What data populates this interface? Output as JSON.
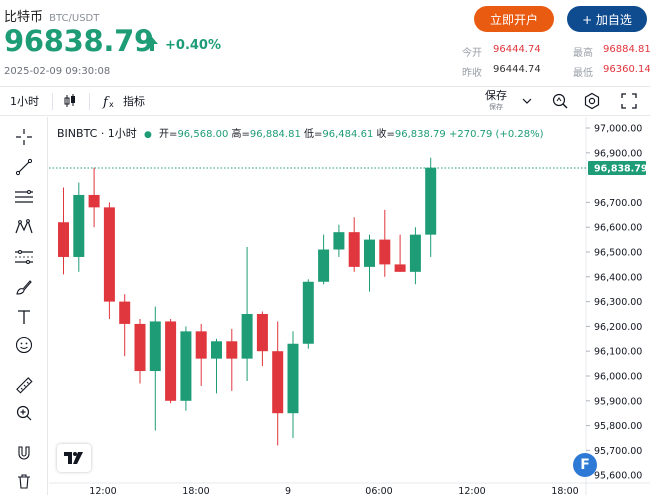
{
  "header": {
    "coin_name": "比特币",
    "pair": "BTC/USDT",
    "price": "96838.79",
    "change_pct": "+0.40%",
    "timestamp": "2025-02-09 09:30:08",
    "open_account_label": "立即开户",
    "add_watchlist_label": "+ 加自选",
    "stats": {
      "open_label": "今开",
      "open_value": "96444.74",
      "high_label": "最高",
      "high_value": "96884.81",
      "prev_close_label": "昨收",
      "prev_close_value": "96444.74",
      "low_label": "最低",
      "low_value": "96360.14"
    },
    "colors": {
      "up": "#1e9c76",
      "down": "#e0363d",
      "open_btn": "#ea5b12",
      "add_btn": "#0f4b8f"
    }
  },
  "toolbar": {
    "interval": "1小时",
    "indicators_label": "指标",
    "save_label": "保存",
    "save_sub_label": "保存",
    "icons": [
      "candles-icon",
      "indicators-icon",
      "alert-icon",
      "settings-icon",
      "fullscreen-icon"
    ]
  },
  "left_tools": [
    "crosshair-icon",
    "trendline-icon",
    "horizontal-lines-icon",
    "pattern-icon",
    "measure-icon",
    "brush-icon",
    "text-icon",
    "emoji-icon",
    "ruler-icon",
    "zoom-icon",
    "magnet-icon",
    "trash-icon"
  ],
  "legend": {
    "symbol": "BINBTC · 1小时",
    "open_label": "开=",
    "open": "96,568.00",
    "high_label": "高=",
    "high": "96,884.81",
    "low_label": "低=",
    "low": "96,484.61",
    "close_label": "收=",
    "close": "96,838.79",
    "change": "+270.79 (+0.28%)"
  },
  "chart_data": {
    "type": "candlestick",
    "title": "BINBTC · 1小时",
    "y_ticks": [
      "97,000.00",
      "96,900.00",
      "96,700.00",
      "96,600.00",
      "96,500.00",
      "96,400.00",
      "96,300.00",
      "96,200.00",
      "96,100.00",
      "96,000.00",
      "95,900.00",
      "95,800.00",
      "95,700.00",
      "95,600.00"
    ],
    "y_tick_values": [
      97000,
      96900,
      96700,
      96600,
      96500,
      96400,
      96300,
      96200,
      96100,
      96000,
      95900,
      95800,
      95700,
      95600
    ],
    "x_ticks": [
      "12:00",
      "18:00",
      "9",
      "06:00",
      "12:00",
      "18:00"
    ],
    "current_price_label": "96,838.79",
    "current_price": 96838.79,
    "ylim": [
      95600,
      97000
    ],
    "candles": [
      {
        "o": 96620,
        "h": 96760,
        "l": 96410,
        "c": 96480
      },
      {
        "o": 96480,
        "h": 96780,
        "l": 96420,
        "c": 96730
      },
      {
        "o": 96730,
        "h": 96840,
        "l": 96600,
        "c": 96680
      },
      {
        "o": 96680,
        "h": 96700,
        "l": 96230,
        "c": 96300
      },
      {
        "o": 96300,
        "h": 96330,
        "l": 96080,
        "c": 96210
      },
      {
        "o": 96210,
        "h": 96230,
        "l": 95970,
        "c": 96020
      },
      {
        "o": 96020,
        "h": 96280,
        "l": 95780,
        "c": 96220
      },
      {
        "o": 96220,
        "h": 96230,
        "l": 95890,
        "c": 95900
      },
      {
        "o": 95900,
        "h": 96200,
        "l": 95860,
        "c": 96180
      },
      {
        "o": 96180,
        "h": 96210,
        "l": 95960,
        "c": 96070
      },
      {
        "o": 96070,
        "h": 96150,
        "l": 95930,
        "c": 96140
      },
      {
        "o": 96140,
        "h": 96190,
        "l": 95940,
        "c": 96070
      },
      {
        "o": 96070,
        "h": 96520,
        "l": 95980,
        "c": 96250
      },
      {
        "o": 96250,
        "h": 96260,
        "l": 96040,
        "c": 96100
      },
      {
        "o": 96100,
        "h": 96220,
        "l": 95720,
        "c": 95850
      },
      {
        "o": 95850,
        "h": 96180,
        "l": 95750,
        "c": 96130
      },
      {
        "o": 96130,
        "h": 96390,
        "l": 96110,
        "c": 96380
      },
      {
        "o": 96380,
        "h": 96570,
        "l": 96370,
        "c": 96510
      },
      {
        "o": 96510,
        "h": 96610,
        "l": 96480,
        "c": 96580
      },
      {
        "o": 96580,
        "h": 96640,
        "l": 96420,
        "c": 96440
      },
      {
        "o": 96440,
        "h": 96570,
        "l": 96340,
        "c": 96550
      },
      {
        "o": 96550,
        "h": 96670,
        "l": 96400,
        "c": 96450
      },
      {
        "o": 96450,
        "h": 96570,
        "l": 96420,
        "c": 96420
      },
      {
        "o": 96420,
        "h": 96600,
        "l": 96370,
        "c": 96570
      },
      {
        "o": 96570,
        "h": 96880,
        "l": 96480,
        "c": 96840
      }
    ]
  }
}
